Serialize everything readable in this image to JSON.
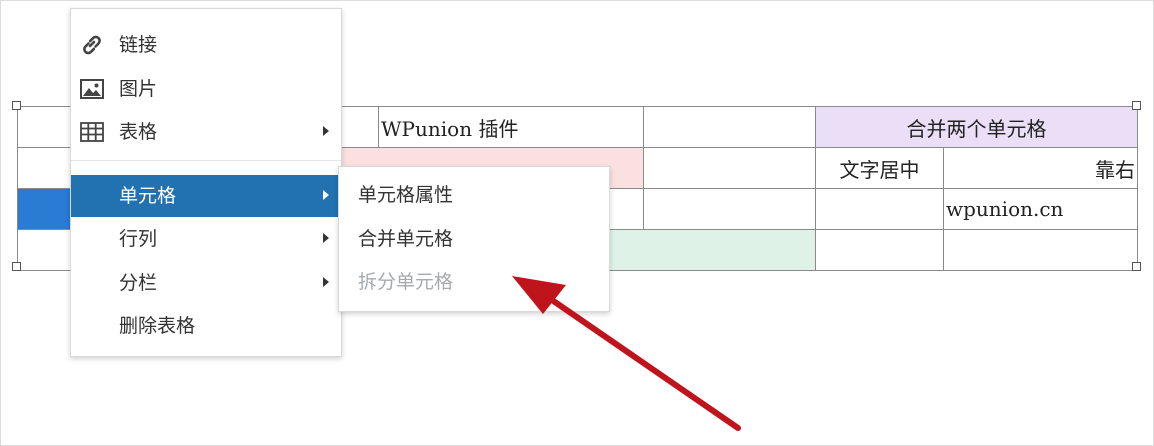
{
  "table": {
    "rows": [
      [
        "",
        "",
        "WPunion 插件",
        "",
        "合并两个单元格"
      ],
      [
        "",
        "",
        "",
        "",
        "文字居中",
        "靠右"
      ],
      [
        "",
        "",
        "",
        "",
        "",
        "wpunion.cn"
      ],
      [
        "",
        "",
        "",
        "",
        "",
        ""
      ]
    ]
  },
  "context_menu": {
    "items": [
      {
        "label": "链接",
        "icon": "link-icon"
      },
      {
        "label": "图片",
        "icon": "image-icon"
      },
      {
        "label": "表格",
        "icon": "table-icon",
        "submenu": true
      },
      {
        "label": "单元格",
        "submenu": true,
        "active": true
      },
      {
        "label": "行列",
        "submenu": true
      },
      {
        "label": "分栏",
        "submenu": true
      },
      {
        "label": "删除表格"
      }
    ]
  },
  "cell_submenu": {
    "items": [
      {
        "label": "单元格属性"
      },
      {
        "label": "合并单元格"
      },
      {
        "label": "拆分单元格",
        "disabled": true
      }
    ]
  },
  "colors": {
    "active_menu_bg": "#2271b1",
    "selected_cell": "#2a7bd3",
    "pink_cell": "#fbe0e0",
    "green_cell": "#dff2e8",
    "purple_cell": "#eadff7",
    "annotation_arrow": "#c0141c"
  }
}
